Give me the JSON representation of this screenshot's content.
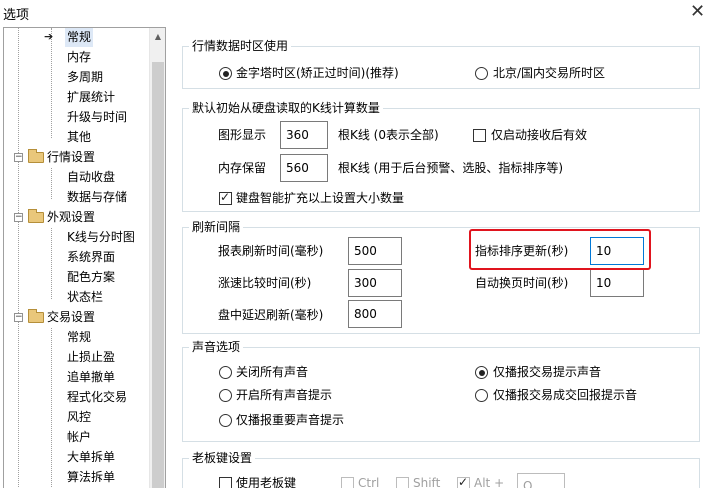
{
  "window": {
    "title": "选项",
    "close_glyph": "✕"
  },
  "tree": {
    "items": [
      {
        "label": "常规"
      },
      {
        "label": "内存"
      },
      {
        "label": "多周期"
      },
      {
        "label": "扩展统计"
      },
      {
        "label": "升级与时间"
      },
      {
        "label": "其他"
      },
      {
        "label": "行情设置"
      },
      {
        "label": "自动收盘"
      },
      {
        "label": "数据与存储"
      },
      {
        "label": "外观设置"
      },
      {
        "label": "K线与分时图"
      },
      {
        "label": "系统界面"
      },
      {
        "label": "配色方案"
      },
      {
        "label": "状态栏"
      },
      {
        "label": "交易设置"
      },
      {
        "label": "常规"
      },
      {
        "label": "止损止盈"
      },
      {
        "label": "追单撤单"
      },
      {
        "label": "程式化交易"
      },
      {
        "label": "风控"
      },
      {
        "label": "帐户"
      },
      {
        "label": "大单拆单"
      },
      {
        "label": "算法拆单"
      }
    ],
    "expander_minus": "−",
    "selected_marker": "➔",
    "scroll_up": "▲"
  },
  "timezone": {
    "title": "行情数据时区使用",
    "option_golden": "金字塔时区(矫正过时间)(推荐)",
    "option_beijing": "北京/国内交易所时区"
  },
  "kline": {
    "title": "默认初始从硬盘读取的K线计算数量",
    "graph_label": "图形显示",
    "graph_value": "360",
    "graph_note": "根K线 (0表示全部)",
    "only_after_start": "仅启动接收后有效",
    "mem_label": "内存保留",
    "mem_value": "560",
    "mem_note": "根K线 (用于后台预警、选股、指标排序等)",
    "auto_expand": "键盘智能扩充以上设置大小数量"
  },
  "refresh": {
    "title": "刷新间隔",
    "report_label": "报表刷新时间(毫秒)",
    "report_value": "500",
    "indicator_label": "指标排序更新(秒)",
    "indicator_value": "10",
    "speed_label": "涨速比较时间(秒)",
    "speed_value": "300",
    "autopage_label": "自动换页时间(秒)",
    "autopage_value": "10",
    "delay_label": "盘中延迟刷新(毫秒)",
    "delay_value": "800"
  },
  "sound": {
    "title": "声音选项",
    "off_all": "关闭所有声音",
    "trade_only": "仅播报交易提示声音",
    "on_all": "开启所有声音提示",
    "trade_return": "仅播报交易成交回报提示音",
    "important_only": "仅播报重要声音提示"
  },
  "boss_key": {
    "title": "老板键设置",
    "use": "使用老板键",
    "ctrl": "Ctrl",
    "shift": "Shift",
    "alt": "Alt +",
    "key": "Q"
  },
  "colors": {
    "highlight": "#e0141e",
    "focus": "#0078d7",
    "selected_bg": "#dde8f6"
  }
}
